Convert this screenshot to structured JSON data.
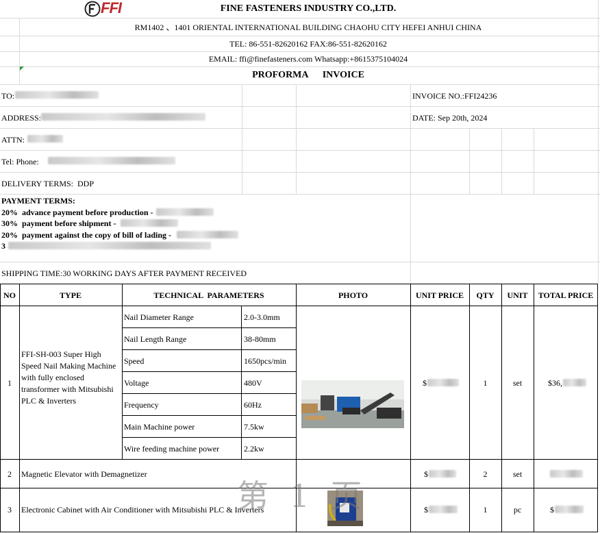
{
  "header": {
    "logo_text": "FFI",
    "company": "FINE FASTENERS INDUSTRY CO.,LTD.",
    "address": "RM1402 、1401 ORIENTAL INTERNATIONAL BUILDING CHAOHU CITY HEFEI ANHUI CHINA",
    "tel_fax": "TEL: 86-551-82620162  FAX:86-551-82620162",
    "email": "EMAIL: ffi@finefasteners.com Whatsapp:+8615375104024",
    "doc_title": "PROFORMA      INVOICE"
  },
  "info": {
    "to_label": "TO:",
    "address_label": "ADDRESS:",
    "attn_label": "ATTN:",
    "tel_label": "Tel: Phone: ",
    "delivery_terms": "DELIVERY TERMS:  DDP",
    "invoice_no": "INVOICE NO.:FFI24236",
    "date": "DATE: Sep 20th, 2024"
  },
  "payment": {
    "title": "PAYMENT TERMS:",
    "lines": [
      "20%  advance payment before production -",
      "30%  payment before shipment -",
      "20%  payment against the copy of bill of lading -",
      "3"
    ]
  },
  "shipping_time": "SHIPPING TIME:30 WORKING DAYS AFTER PAYMENT RECEIVED",
  "table": {
    "headers": [
      "NO",
      "TYPE",
      "TECHNICAL  PARAMETERS",
      "PHOTO",
      "UNIT PRICE",
      "QTY",
      "UNIT",
      "TOTAL PRICE"
    ],
    "rows": [
      {
        "no": "1",
        "type": "FFI-SH-003 Super High Speed Nail Making Machine with fully enclosed transformer with Mitsubishi PLC & Inverters",
        "params": [
          {
            "name": "Nail Diameter Range",
            "value": "2.0-3.0mm"
          },
          {
            "name": "Nail Length Range",
            "value": "38-80mm"
          },
          {
            "name": "Speed",
            "value": "1650pcs/min"
          },
          {
            "name": "Voltage",
            "value": "480V"
          },
          {
            "name": "Frequency",
            "value": "60Hz"
          },
          {
            "name": "Main Machine power",
            "value": "7.5kw"
          },
          {
            "name": "Wire feeding machine power",
            "value": "2.2kw"
          }
        ],
        "unit_price_prefix": "$",
        "qty": "1",
        "unit": "set",
        "total_prefix": "$36,"
      },
      {
        "no": "2",
        "type": "Magnetic Elevator with Demagnetizer",
        "unit_price_prefix": "$",
        "qty": "2",
        "unit": "set",
        "total_prefix": ""
      },
      {
        "no": "3",
        "type": "Electronic Cabinet with Air Conditioner with Mitsubishi PLC & Inverters",
        "unit_price_prefix": "$",
        "qty": "1",
        "unit": "pc",
        "total_prefix": "$"
      }
    ]
  },
  "watermark": "第 1 页",
  "colors": {
    "logo_red": "#c0282d",
    "grid": "#d9d9d9",
    "border": "#000000"
  }
}
